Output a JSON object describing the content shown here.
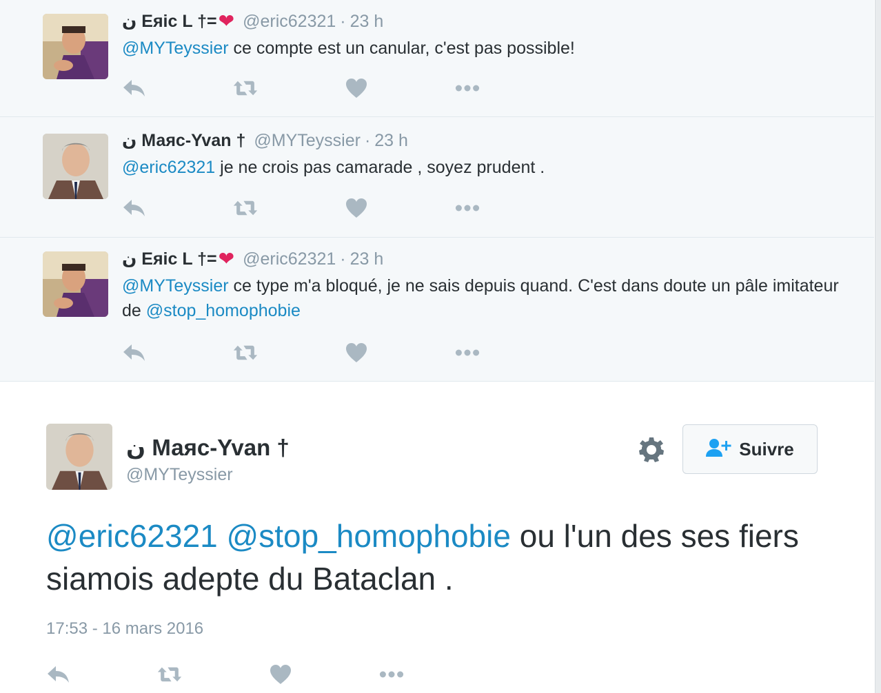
{
  "replies": [
    {
      "fullname": "ن Eяic L †=",
      "has_heart": true,
      "screen_name": "@eric62321",
      "time": "23 h",
      "text_parts": [
        {
          "type": "mention",
          "text": "@MYTeyssier"
        },
        {
          "type": "text",
          "text": " ce compte est un canular, c'est pas possible!"
        }
      ]
    },
    {
      "fullname": "ن Маяс-Yvan †",
      "has_heart": false,
      "screen_name": "@MYTeyssier",
      "time": "23 h",
      "text_parts": [
        {
          "type": "mention",
          "text": "@eric62321"
        },
        {
          "type": "text",
          "text": " je ne crois pas camarade , soyez prudent ."
        }
      ]
    },
    {
      "fullname": "ن Eяic L †=",
      "has_heart": true,
      "screen_name": "@eric62321",
      "time": "23 h",
      "text_parts": [
        {
          "type": "mention",
          "text": "@MYTeyssier"
        },
        {
          "type": "text",
          "text": " ce type m'a bloqué, je ne sais depuis quand. C'est dans doute un pâle imitateur de "
        },
        {
          "type": "mention",
          "text": "@stop_homophobie"
        }
      ]
    }
  ],
  "main": {
    "fullname": "ن Маяс-Yvan †",
    "screen_name": "@MYTeyssier",
    "follow_label": "Suivre",
    "text_parts": [
      {
        "type": "mention",
        "text": "@eric62321"
      },
      {
        "type": "text",
        "text": " "
      },
      {
        "type": "mention",
        "text": "@stop_homophobie"
      },
      {
        "type": "text",
        "text": " ou l'un des ses fiers siamois adepte du Bataclan ."
      }
    ],
    "timestamp": "17:53 - 16 mars 2016"
  },
  "icons": {
    "reply": "reply-icon",
    "retweet": "retweet-icon",
    "like": "heart-icon",
    "more": "more-icon",
    "settings": "gear-icon",
    "follow": "follow-user-icon"
  },
  "colors": {
    "mention": "#1b8ac4",
    "heart_emoji": "#e0245e",
    "action_icon": "#aab8c2",
    "follow_icon": "#1da1f2",
    "muted_text": "#8899a6"
  }
}
